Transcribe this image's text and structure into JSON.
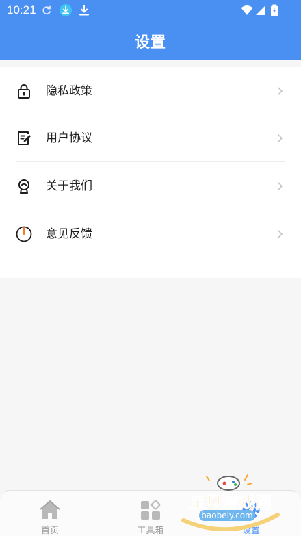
{
  "status_bar": {
    "time": "10:21",
    "icons": [
      "sync-icon",
      "download-badge-icon",
      "download-icon",
      "wifi-icon",
      "signal-icon",
      "battery-icon"
    ]
  },
  "header": {
    "title": "设置"
  },
  "settings": {
    "items": [
      {
        "label": "隐私政策",
        "icon": "lock-icon"
      },
      {
        "label": "用户协议",
        "icon": "agreement-icon"
      },
      {
        "label": "关于我们",
        "icon": "about-icon"
      },
      {
        "label": "意见反馈",
        "icon": "feedback-icon"
      }
    ]
  },
  "tab_bar": {
    "tabs": [
      {
        "label": "首页",
        "icon": "home-icon",
        "active": false
      },
      {
        "label": "工具箱",
        "icon": "toolbox-icon",
        "active": false
      },
      {
        "label": "设置",
        "icon": "settings-icon",
        "active": true
      }
    ]
  },
  "watermark": {
    "title": "宝贝游戏网",
    "url": "baobeiy.com"
  },
  "colors": {
    "primary": "#4a90f3",
    "background": "#f6f6f7",
    "card": "#ffffff",
    "text": "#222222",
    "inactive_tab": "#9a9a9a",
    "watermark_text": "#f5a623"
  }
}
